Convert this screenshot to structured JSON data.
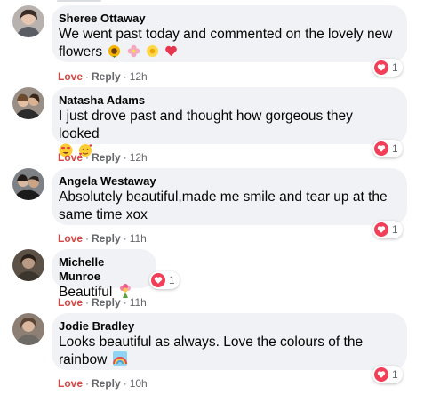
{
  "comments": [
    {
      "name": "Sheree Ottaway",
      "line1": "We went past today and commented on the lovely new",
      "line2": "flowers",
      "love": "Love",
      "reply": "Reply",
      "time": "12h",
      "reactions": "1",
      "emojis": [
        "sunflower",
        "blossom",
        "sunflower",
        "heart"
      ]
    },
    {
      "name": "Natasha Adams",
      "line1": "I just drove past and thought how gorgeous they looked",
      "line2": "",
      "love": "Love",
      "reply": "Reply",
      "time": "12h",
      "reactions": "1",
      "emojis": [
        "heart-eyes",
        "smiling-hearts"
      ]
    },
    {
      "name": "Angela Westaway",
      "line1": "Absolutely beautiful,made me smile and tear up at the",
      "line2": "same time xox",
      "love": "Love",
      "reply": "Reply",
      "time": "11h",
      "reactions": "1"
    },
    {
      "name": "Michelle Munroe",
      "line1": "Beautiful",
      "line2": "",
      "love": "Love",
      "reply": "Reply",
      "time": "11h",
      "reactions": "1",
      "emojis": [
        "bouquet"
      ]
    },
    {
      "name": "Jodie Bradley",
      "line1": "Looks beautiful as always. Love the colours of the",
      "line2": "rainbow",
      "love": "Love",
      "reply": "Reply",
      "time": "10h",
      "reactions": "1",
      "emojis": [
        "rainbow"
      ]
    }
  ],
  "colors": {
    "love": "#d64541",
    "bubble": "#f0f2f5",
    "heart": "#f33e58",
    "meta": "#65676b"
  }
}
